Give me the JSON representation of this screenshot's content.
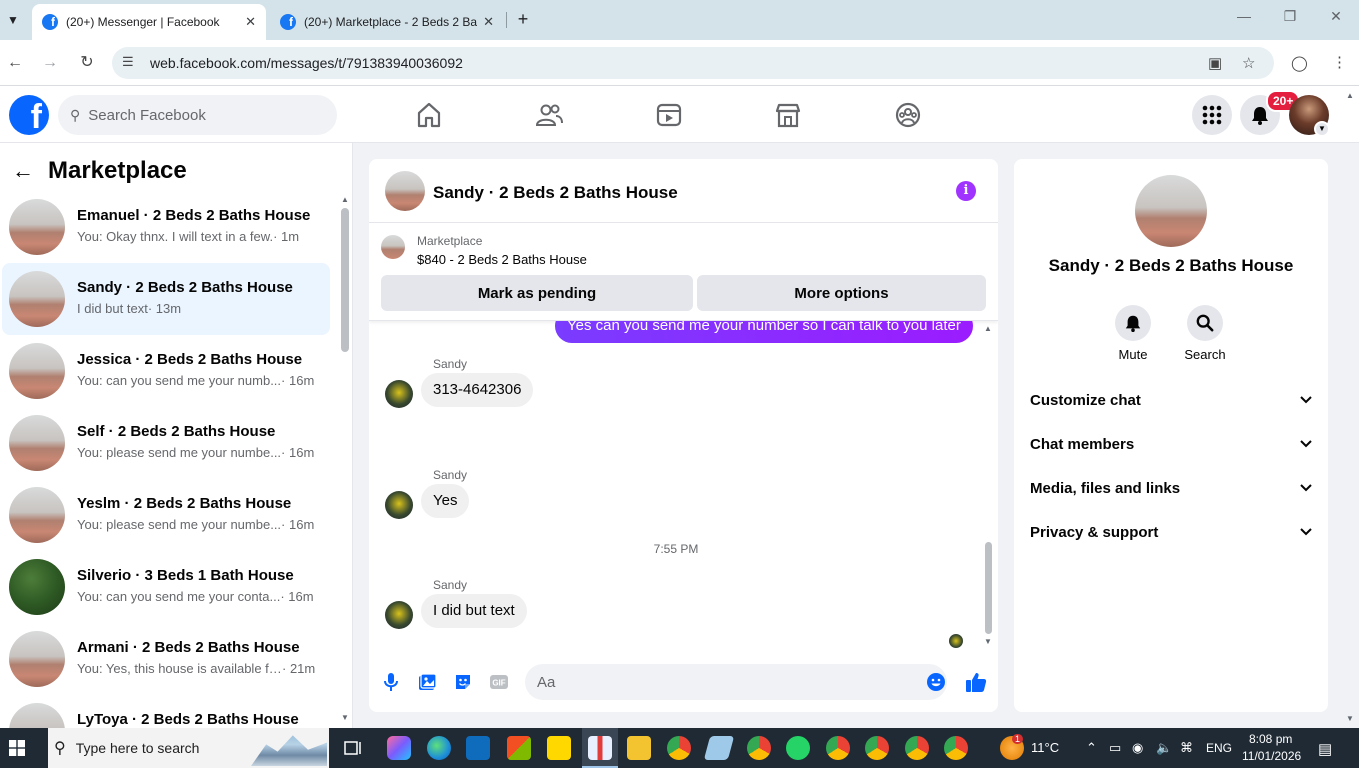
{
  "browser": {
    "tabs": [
      {
        "label": "(20+) Messenger | Facebook",
        "active": true
      },
      {
        "label": "(20+) Marketplace - 2 Beds 2 Ba",
        "active": false
      }
    ],
    "url": "web.facebook.com/messages/t/791383940036092"
  },
  "header": {
    "logo": "f",
    "search_placeholder": "Search Facebook",
    "notification_badge": "20+"
  },
  "sidebar": {
    "title": "Marketplace",
    "conversations": [
      {
        "name": "Emanuel · 2 Beds 2 Baths House",
        "preview": "You: Okay thnx. I will text in a few.",
        "time": "· 1m",
        "selected": false
      },
      {
        "name": "Sandy · 2 Beds 2 Baths House",
        "preview": "I did but text",
        "time": "· 13m",
        "selected": true
      },
      {
        "name": "Jessica · 2 Beds 2 Baths House",
        "preview": "You: can you send me your numb...",
        "time": " · 16m",
        "selected": false
      },
      {
        "name": "Self · 2 Beds 2 Baths House",
        "preview": "You: please send me your numbe...",
        "time": " · 16m",
        "selected": false
      },
      {
        "name": "Yeslm · 2 Beds 2 Baths House",
        "preview": "You: please send me your numbe...",
        "time": " · 16m",
        "selected": false
      },
      {
        "name": "Silverio · 3 Beds 1 Bath House",
        "preview": "You: can you send me your conta...",
        "time": " · 16m",
        "selected": false
      },
      {
        "name": "Armani · 2 Beds 2 Baths House",
        "preview": "You: Yes, this house is available fo...",
        "time": " · 21m",
        "selected": false
      },
      {
        "name": "LyToya · 2 Beds 2 Baths House",
        "preview": "",
        "time": "",
        "selected": false
      }
    ]
  },
  "chat": {
    "title": "Sandy · 2 Beds 2 Baths House",
    "listing": {
      "category": "Marketplace",
      "price_title": "$840 - 2 Beds 2 Baths House",
      "mark_pending": "Mark as pending",
      "more_options": "More options"
    },
    "messages": {
      "outgoing": "Yes  can you send me your number so I can talk to you later",
      "sender": "Sandy",
      "in1": "313-4642306",
      "in2": "Yes",
      "timestamp": "7:55 PM",
      "in3": "I did but text"
    },
    "composer_placeholder": "Aa"
  },
  "info_panel": {
    "name": "Sandy · 2 Beds 2 Baths House",
    "mute_label": "Mute",
    "search_label": "Search",
    "sections": [
      "Customize chat",
      "Chat members",
      "Media, files and links",
      "Privacy & support"
    ]
  },
  "taskbar": {
    "search_text": "Type here to search",
    "weather_badge": "1",
    "temperature": "11°C",
    "language": "ENG",
    "time": "8:08 pm",
    "date": "11/01/2026"
  },
  "colors": {
    "fb_blue": "#0866ff",
    "messenger_purple": "#8a1cff",
    "selected_row": "#ebf5ff",
    "badge_red": "#e41e3f"
  }
}
